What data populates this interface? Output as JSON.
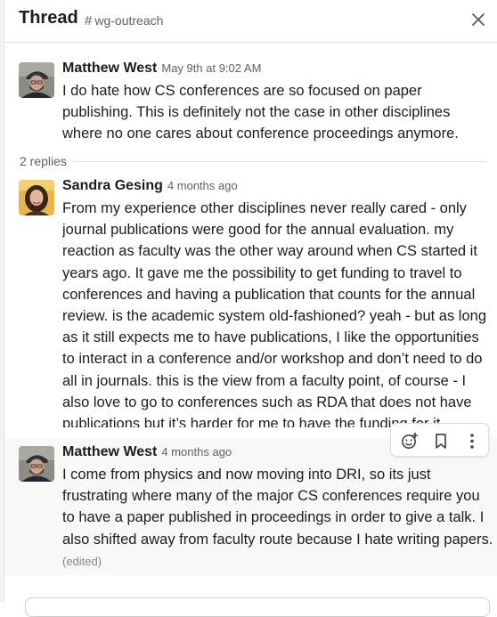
{
  "header": {
    "title": "Thread",
    "channel": "wg-outreach"
  },
  "messages": [
    {
      "author": "Matthew West",
      "time": "May 9th at 9:02 AM",
      "text": "I do hate how CS conferences are so focused on paper publishing. This is definitely not the case in other disciplines where no one cares about conference proceedings anymore."
    },
    {
      "author": "Sandra Gesing",
      "time": "4 months ago",
      "text": "From my experience other disciplines never really cared - only journal publications were good for the annual evaluation. my reaction as faculty was the other way around when CS started it years ago. It gave me the possibility to get funding to travel to conferences and having a publication that counts for the annual review. is the academic system old-fashioned? yeah - but as long as it still expects me to have publications, I like the opportunities to interact in a conference and/or workshop and don’t need to do all in journals. this is the view from a faculty point, of course - I also love to go to conferences such as RDA that does not have publications but it’s harder for me to have the funding for it."
    },
    {
      "author": "Matthew West",
      "time": "4 months ago",
      "text": "I come from physics and now moving into DRI, so its just frustrating where many of the major CS conferences require you to have a paper published in proceedings in order to give a talk. I also shifted away from faculty route because I hate writing papers.",
      "edited": "(edited)"
    }
  ],
  "replies": "2 replies",
  "icons": {
    "close": "close-icon",
    "hash": "hash-icon",
    "emoji": "add-reaction-icon",
    "bookmark": "bookmark-icon",
    "more": "more-vertical-icon"
  },
  "colors": {
    "text": "#1d1c1d",
    "muted": "#616061",
    "hover_background": "#f8f8f8",
    "border": "#dddddd"
  }
}
